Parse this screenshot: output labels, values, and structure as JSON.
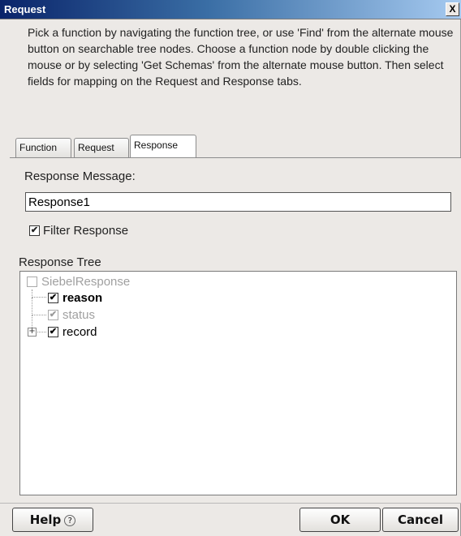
{
  "window": {
    "title": "Request",
    "close_label": "X"
  },
  "instructions": "Pick a function by navigating the function tree, or use 'Find' from the alternate mouse button on searchable tree nodes. Choose a function node by double clicking the mouse or by selecting 'Get Schemas' from the alternate mouse button. Then select fields for mapping on the Request and Response tabs.",
  "tabs": [
    {
      "label": "Function",
      "active": false
    },
    {
      "label": "Request",
      "active": false
    },
    {
      "label": "Response",
      "active": true
    }
  ],
  "response_message": {
    "label": "Response Message:",
    "value": "Response1"
  },
  "filter_response": {
    "label": "Filter Response",
    "checked": true
  },
  "response_tree": {
    "label": "Response Tree",
    "nodes": [
      {
        "label": "SiebelResponse",
        "checked": false,
        "disabled": true
      },
      {
        "label": "reason",
        "checked": true,
        "bold": true
      },
      {
        "label": "status",
        "checked": true,
        "disabled": true
      },
      {
        "label": "record",
        "checked": true,
        "expandable": true
      }
    ]
  },
  "footer": {
    "help_label": "Help",
    "help_icon": "?",
    "ok_label": "OK",
    "cancel_label": "Cancel"
  }
}
